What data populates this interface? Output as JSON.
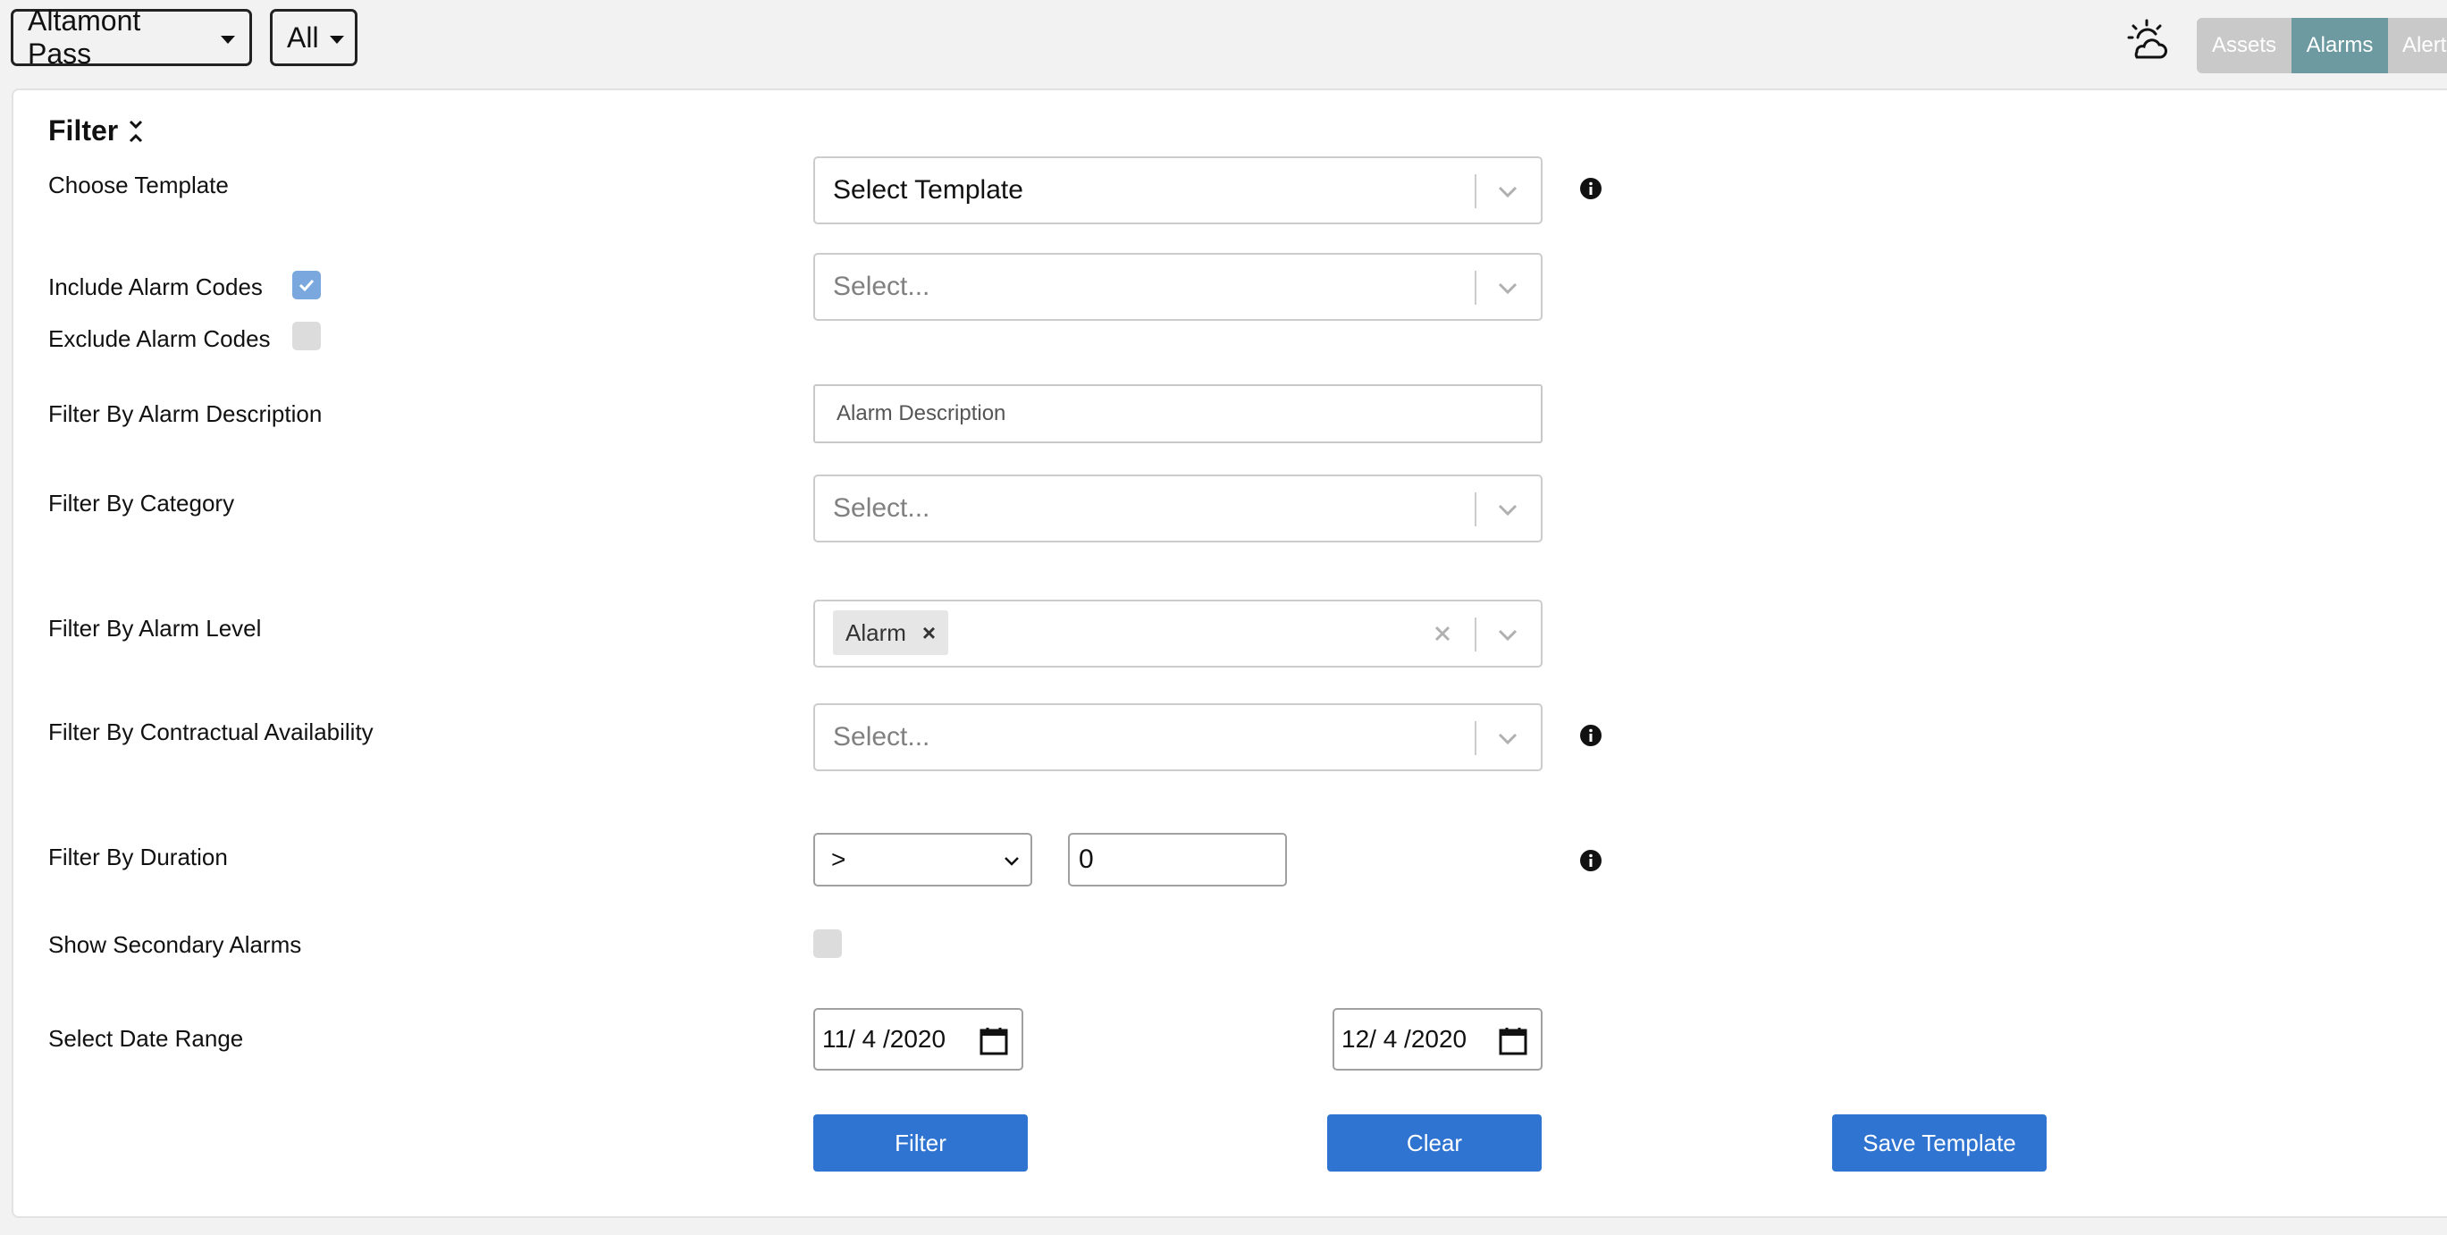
{
  "topbar": {
    "site_label": "Altamont Pass",
    "scope_label": "All",
    "weather_icon": "partly-cloudy-icon",
    "tabs": [
      {
        "label": "Assets",
        "active": false
      },
      {
        "label": "Alarms",
        "active": true
      },
      {
        "label": "Alerts",
        "active": false
      }
    ]
  },
  "colors": {
    "active_tab": "#6c9aa0",
    "inactive_tab": "#c9c9c9",
    "primary_button": "#2f74d0",
    "checkbox_checked": "#7aa7dd"
  },
  "filter": {
    "title": "Filter",
    "choose_template": {
      "label": "Choose Template",
      "value": "Select Template"
    },
    "include_alarm_codes": {
      "label": "Include Alarm Codes",
      "checked": true
    },
    "exclude_alarm_codes": {
      "label": "Exclude Alarm Codes",
      "checked": false
    },
    "alarm_codes_select": {
      "placeholder": "Select..."
    },
    "alarm_description": {
      "label": "Filter By Alarm Description",
      "placeholder": "Alarm Description"
    },
    "category": {
      "label": "Filter By Category",
      "placeholder": "Select..."
    },
    "alarm_level": {
      "label": "Filter By Alarm Level",
      "selected": [
        "Alarm"
      ]
    },
    "contractual_availability": {
      "label": "Filter By Contractual Availability",
      "placeholder": "Select..."
    },
    "duration": {
      "label": "Filter By Duration",
      "operator": ">",
      "value": "0"
    },
    "secondary_alarms": {
      "label": "Show Secondary Alarms",
      "checked": false
    },
    "date_range": {
      "label": "Select Date Range",
      "start": "11/ 4 /2020",
      "end": "12/ 4 /2020"
    },
    "buttons": {
      "filter": "Filter",
      "clear": "Clear",
      "save_template": "Save Template"
    }
  }
}
